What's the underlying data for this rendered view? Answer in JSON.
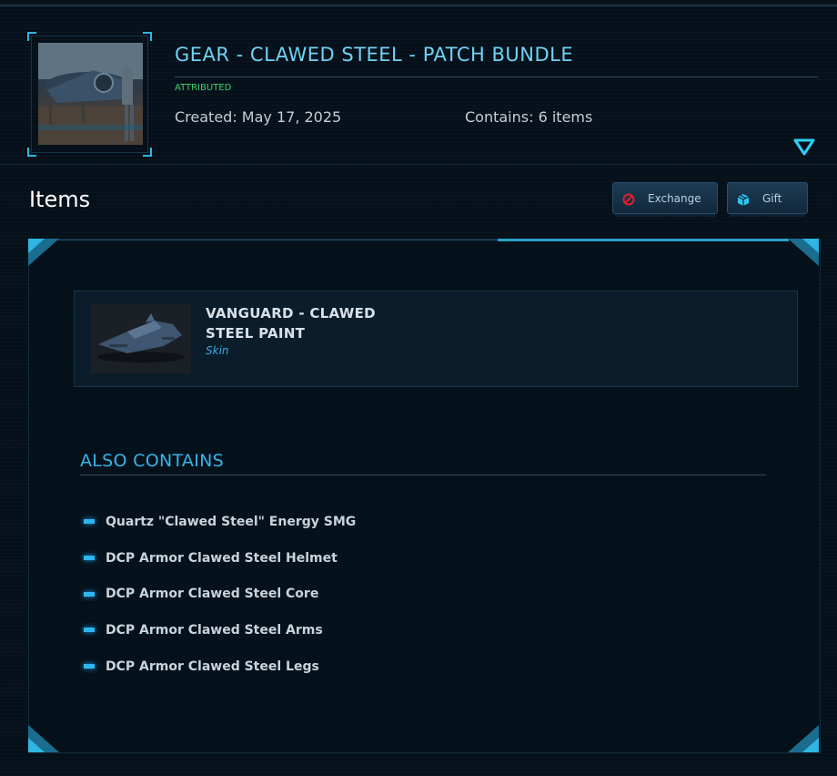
{
  "header": {
    "title": "GEAR - CLAWED STEEL - PATCH BUNDLE",
    "status": "ATTRIBUTED",
    "created": "Created: May 17, 2025",
    "contains": "Contains: 6 items",
    "status_color": "#3bd36a"
  },
  "items_section": {
    "heading": "Items",
    "exchange_label": "Exchange",
    "gift_label": "Gift"
  },
  "main_item": {
    "name_line1": "VANGUARD - CLAWED",
    "name_line2": "STEEL PAINT",
    "type": "Skin"
  },
  "also_contains": {
    "heading": "ALSO CONTAINS",
    "items": [
      "Quartz \"Clawed Steel\" Energy SMG",
      "DCP Armor Clawed Steel Helmet",
      "DCP Armor Clawed Steel Core",
      "DCP Armor Clawed Steel Arms",
      "DCP Armor Clawed Steel Legs"
    ]
  },
  "icons": {
    "expand": "triangle-down-icon",
    "exchange": "no-entry-icon",
    "gift": "gift-box-icon",
    "bullet": "dash-bullet-icon"
  },
  "colors": {
    "accent": "#2fb6e0",
    "title": "#6fd3f5",
    "exchange_icon": "#e0202a"
  }
}
